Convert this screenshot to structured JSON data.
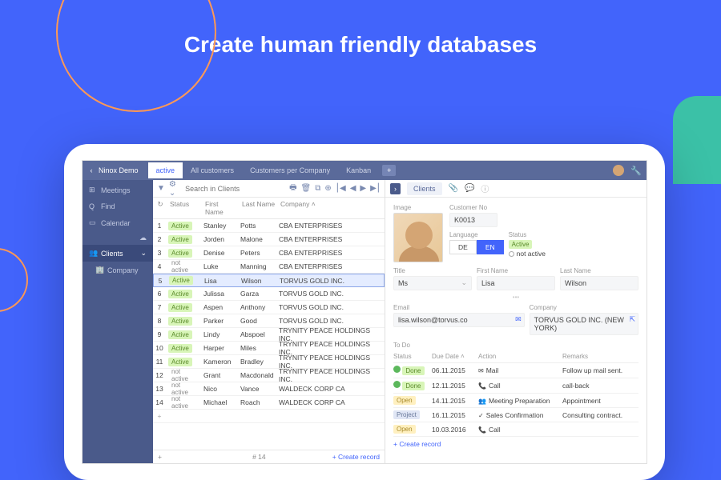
{
  "headline": "Create human friendly databases",
  "topbar": {
    "title": "Ninox Demo",
    "tabs": [
      "active",
      "All customers",
      "Customers per Company",
      "Kanban"
    ]
  },
  "sidebar": {
    "items": [
      {
        "icon": "⊞",
        "label": "Meetings"
      },
      {
        "icon": "Q",
        "label": "Find"
      },
      {
        "icon": "▭",
        "label": "Calendar"
      },
      {
        "icon": "👥",
        "label": "Clients",
        "sel": true,
        "exp": true
      },
      {
        "icon": "🏢",
        "label": "Company",
        "child": true
      }
    ]
  },
  "search_placeholder": "Search in Clients",
  "columns": [
    "Status",
    "First Name",
    "Last Name",
    "Company"
  ],
  "rows": [
    {
      "n": 1,
      "st": "Active",
      "a": true,
      "fn": "Stanley",
      "ln": "Potts",
      "co": "CBA ENTERPRISES"
    },
    {
      "n": 2,
      "st": "Active",
      "a": true,
      "fn": "Jorden",
      "ln": "Malone",
      "co": "CBA ENTERPRISES"
    },
    {
      "n": 3,
      "st": "Active",
      "a": true,
      "fn": "Denise",
      "ln": "Peters",
      "co": "CBA ENTERPRISES"
    },
    {
      "n": 4,
      "st": "not active",
      "a": false,
      "fn": "Luke",
      "ln": "Manning",
      "co": "CBA ENTERPRISES"
    },
    {
      "n": 5,
      "st": "Active",
      "a": true,
      "fn": "Lisa",
      "ln": "Wilson",
      "co": "TORVUS GOLD INC.",
      "sel": true
    },
    {
      "n": 6,
      "st": "Active",
      "a": true,
      "fn": "Julissa",
      "ln": "Garza",
      "co": "TORVUS GOLD INC."
    },
    {
      "n": 7,
      "st": "Active",
      "a": true,
      "fn": "Aspen",
      "ln": "Anthony",
      "co": "TORVUS GOLD INC."
    },
    {
      "n": 8,
      "st": "Active",
      "a": true,
      "fn": "Parker",
      "ln": "Good",
      "co": "TORVUS GOLD INC."
    },
    {
      "n": 9,
      "st": "Active",
      "a": true,
      "fn": "Lindy",
      "ln": "Abspoel",
      "co": "TRYNITY PEACE HOLDINGS INC."
    },
    {
      "n": 10,
      "st": "Active",
      "a": true,
      "fn": "Harper",
      "ln": "Miles",
      "co": "TRYNITY PEACE HOLDINGS INC."
    },
    {
      "n": 11,
      "st": "Active",
      "a": true,
      "fn": "Kameron",
      "ln": "Bradley",
      "co": "TRYNITY PEACE HOLDINGS INC."
    },
    {
      "n": 12,
      "st": "not active",
      "a": false,
      "fn": "Grant",
      "ln": "Macdonald",
      "co": "TRYNITY PEACE HOLDINGS INC."
    },
    {
      "n": 13,
      "st": "not active",
      "a": false,
      "fn": "Nico",
      "ln": "Vance",
      "co": "WALDECK CORP CA"
    },
    {
      "n": 14,
      "st": "not active",
      "a": false,
      "fn": "Michael",
      "ln": "Roach",
      "co": "WALDECK CORP CA"
    }
  ],
  "count": "# 14",
  "create": "+ Create record",
  "detail": {
    "chip": "Clients",
    "labels": {
      "image": "Image",
      "custno": "Customer No",
      "lang": "Language",
      "status": "Status",
      "title": "Title",
      "fn": "First Name",
      "ln": "Last Name",
      "email": "Email",
      "company": "Company",
      "todo": "To Do"
    },
    "custno": "K0013",
    "lang": [
      "DE",
      "EN"
    ],
    "lang_sel": 1,
    "status_opts": [
      "Active",
      "not active"
    ],
    "status_sel": 0,
    "title": "Ms",
    "fn": "Lisa",
    "ln": "Wilson",
    "email": "lisa.wilson@torvus.co",
    "company": "TORVUS GOLD INC. (NEW YORK)",
    "todo_cols": [
      "Status",
      "Due Date",
      "Action",
      "Remarks"
    ],
    "todo": [
      {
        "st": "Done",
        "cls": "done",
        "dt": "06.11.2015",
        "ico": "✉",
        "ac": "Mail",
        "rm": "Follow up mail sent."
      },
      {
        "st": "Done",
        "cls": "done",
        "dt": "12.11.2015",
        "ico": "📞",
        "ac": "Call",
        "rm": "call-back"
      },
      {
        "st": "Open",
        "cls": "open",
        "dt": "14.11.2015",
        "ico": "👥",
        "ac": "Meeting Preparation",
        "rm": "Appointment"
      },
      {
        "st": "Project",
        "cls": "proj",
        "dt": "16.11.2015",
        "ico": "✓",
        "ac": "Sales Confirmation",
        "rm": "Consulting contract."
      },
      {
        "st": "Open",
        "cls": "open",
        "dt": "10.03.2016",
        "ico": "📞",
        "ac": "Call",
        "rm": ""
      }
    ],
    "todo_create": "+ Create record"
  }
}
